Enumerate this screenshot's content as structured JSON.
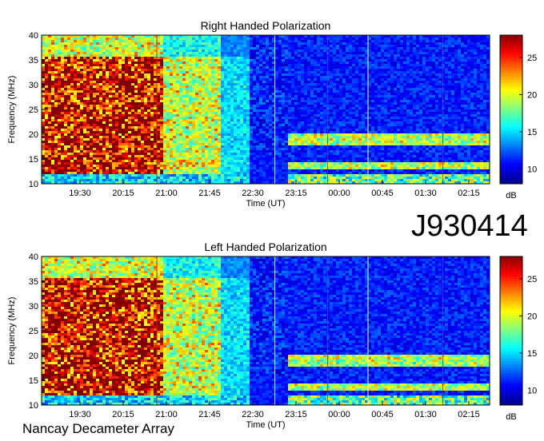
{
  "observation_id": "J930414",
  "instrument": "Nancay Decameter Array",
  "colors": {
    "colormap": [
      "#00008f",
      "#0000ff",
      "#0080ff",
      "#00ffff",
      "#80ff80",
      "#ffff00",
      "#ff8000",
      "#ff0000",
      "#800000"
    ],
    "marker_red": "#cc2200",
    "marker_white": "#ffffff"
  },
  "chart_data": [
    {
      "type": "heatmap",
      "title": "Right Handed Polarization",
      "xlabel": "Time (UT)",
      "ylabel": "Frequency (MHz)",
      "x_ticks": [
        "19:30",
        "20:15",
        "21:00",
        "21:45",
        "22:30",
        "23:15",
        "00:00",
        "00:45",
        "01:30",
        "02:15"
      ],
      "y_ticks": [
        10,
        15,
        20,
        25,
        30,
        35,
        40
      ],
      "ylim": [
        10,
        40
      ],
      "colorbar": {
        "label": "dB",
        "ticks": [
          10,
          15,
          20,
          25
        ],
        "range": [
          8,
          28
        ]
      },
      "vertical_markers": [
        {
          "time": "20:50",
          "color": "red"
        },
        {
          "time": "22:53",
          "color": "white"
        },
        {
          "time": "23:48",
          "color": "red"
        },
        {
          "time": "00:30",
          "color": "white"
        },
        {
          "time": "01:48",
          "color": "red"
        }
      ],
      "data_gap": {
        "from": "22:25",
        "to": "23:05"
      }
    },
    {
      "type": "heatmap",
      "title": "Left Handed Polarization",
      "xlabel": "Time (UT)",
      "ylabel": "Frequency (MHz)",
      "x_ticks": [
        "19:30",
        "20:15",
        "21:00",
        "21:45",
        "22:30",
        "23:15",
        "00:00",
        "00:45",
        "01:30",
        "02:15"
      ],
      "y_ticks": [
        10,
        15,
        20,
        25,
        30,
        35,
        40
      ],
      "ylim": [
        10,
        40
      ],
      "colorbar": {
        "label": "dB",
        "ticks": [
          10,
          15,
          20,
          25
        ],
        "range": [
          8,
          28
        ]
      },
      "vertical_markers": [
        {
          "time": "20:50",
          "color": "red"
        },
        {
          "time": "22:53",
          "color": "white"
        },
        {
          "time": "23:48",
          "color": "red"
        },
        {
          "time": "00:30",
          "color": "white"
        },
        {
          "time": "01:48",
          "color": "red"
        }
      ],
      "data_gap": {
        "from": "22:25",
        "to": "23:05"
      }
    }
  ]
}
